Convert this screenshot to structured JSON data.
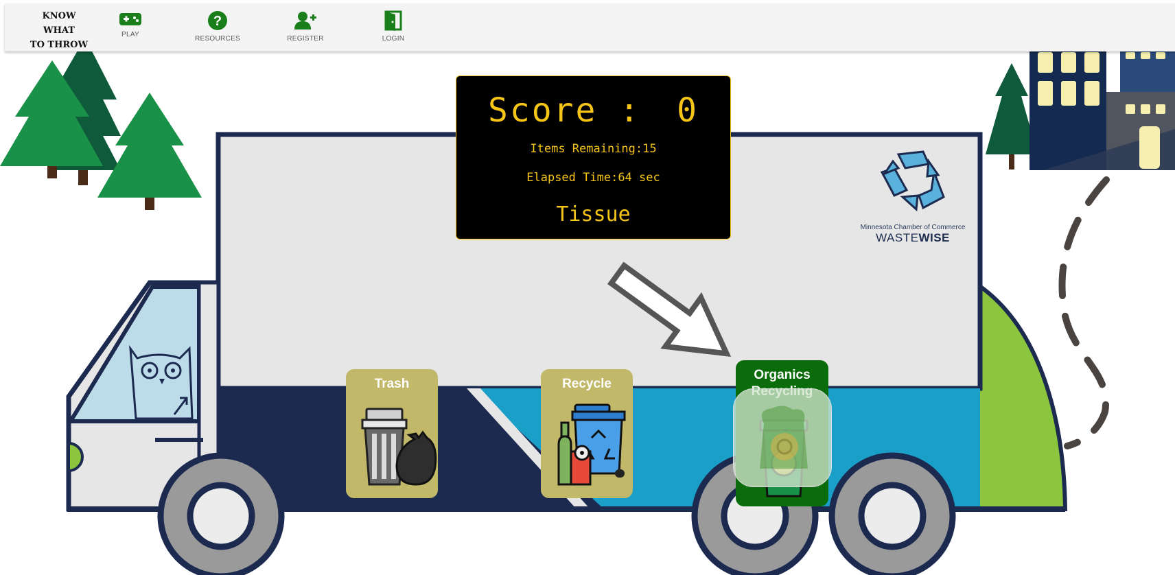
{
  "nav": {
    "brand_lines": [
      "KNOW",
      "WHAT",
      "TO THROW"
    ],
    "items": [
      {
        "label": "PLAY",
        "icon": "gamepad-icon"
      },
      {
        "label": "RESOURCES",
        "icon": "question-circle-icon"
      },
      {
        "label": "REGISTER",
        "icon": "user-plus-icon"
      },
      {
        "label": "LOGIN",
        "icon": "door-icon"
      }
    ]
  },
  "scoreboard": {
    "score_label": "Score :",
    "score_value": "0",
    "items_remaining_label": "Items Remaining:",
    "items_remaining_value": "15",
    "elapsed_label": "Elapsed Time:",
    "elapsed_value": "64 sec",
    "current_item": "Tissue"
  },
  "bins": [
    {
      "label": "Trash",
      "icon": "trash-can-icon"
    },
    {
      "label": "Recycle",
      "icon": "recycle-bin-icon"
    },
    {
      "label": "Organics Recycling",
      "icon": "organics-bin-icon"
    }
  ],
  "drag_item": {
    "name": "Tissue",
    "icon": "tissue-icon"
  },
  "sponsor": {
    "org": "Minnesota Chamber of Commerce",
    "brand_light": "WASTE",
    "brand_bold": "WISE"
  },
  "colors": {
    "nav_icon": "#1a7f1a",
    "scoreboard_text": "#f5c518",
    "bin_tan": "#c2b86a",
    "bin_green": "#0a6c0a",
    "truck_navy": "#1c2a50",
    "truck_teal": "#1a9fc8",
    "truck_green": "#8cc63f"
  }
}
